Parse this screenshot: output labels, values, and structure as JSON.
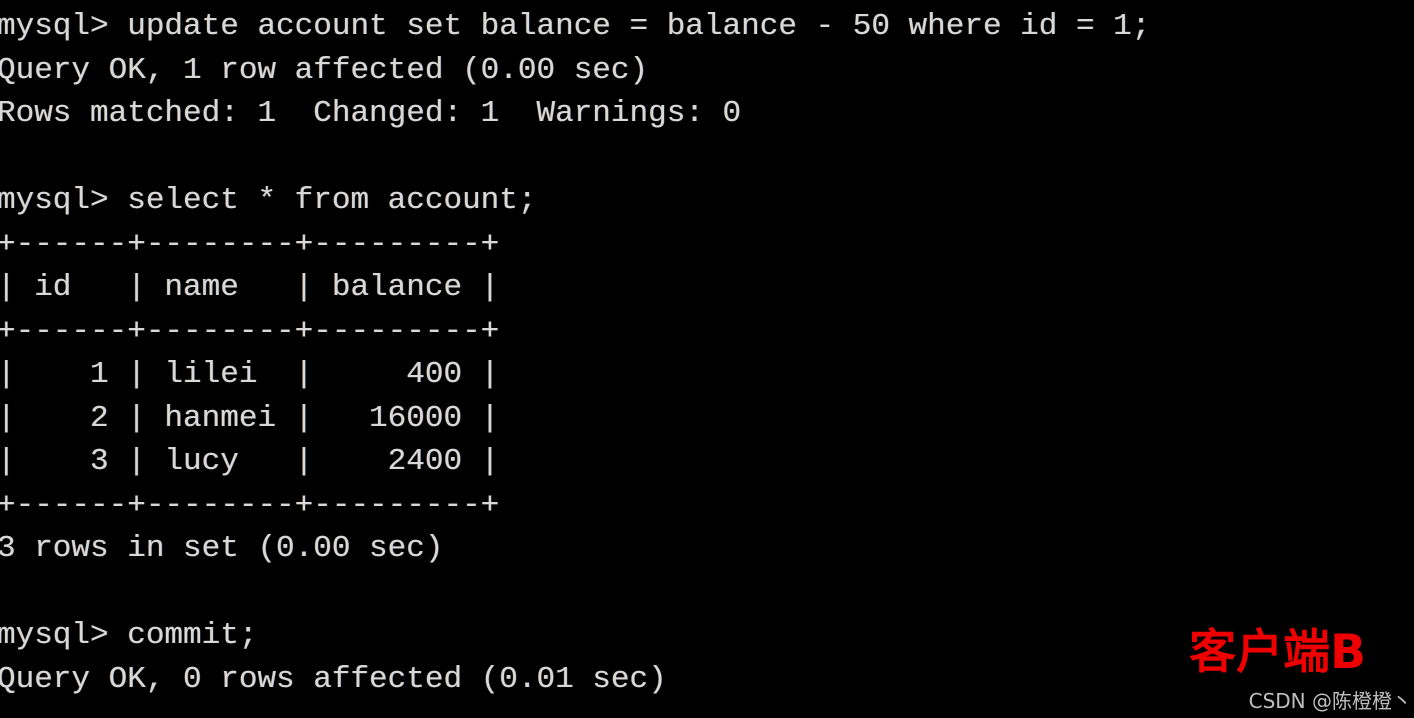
{
  "terminal": {
    "prompt": "mysql>",
    "background_color": "#000000",
    "text_color": "#d8d8d8",
    "lines": [
      "mysql> update account set balance = balance - 50 where id = 1;",
      "Query OK, 1 row affected (0.00 sec)",
      "Rows matched: 1  Changed: 1  Warnings: 0",
      "",
      "mysql> select * from account;",
      "+------+--------+---------+",
      "| id   | name   | balance |",
      "+------+--------+---------+",
      "|    1 | lilei  |     400 |",
      "|    2 | hanmei |   16000 |",
      "|    3 | lucy   |    2400 |",
      "+------+--------+---------+",
      "3 rows in set (0.00 sec)",
      "",
      "mysql> commit;",
      "Query OK, 0 rows affected (0.01 sec)"
    ],
    "commands": [
      "update account set balance = balance - 50 where id = 1;",
      "select * from account;",
      "commit;"
    ],
    "results": [
      {
        "status": "Query OK, 1 row affected (0.00 sec)",
        "detail": "Rows matched: 1  Changed: 1  Warnings: 0"
      },
      {
        "status": "3 rows in set (0.00 sec)",
        "detail": ""
      },
      {
        "status": "Query OK, 0 rows affected (0.01 sec)",
        "detail": ""
      }
    ],
    "result_table": {
      "columns": [
        "id",
        "name",
        "balance"
      ],
      "rows": [
        [
          "1",
          "lilei",
          "400"
        ],
        [
          "2",
          "hanmei",
          "16000"
        ],
        [
          "3",
          "lucy",
          "2400"
        ]
      ],
      "row_count_text": "3 rows in set (0.00 sec)"
    }
  },
  "annotation": {
    "label": "客户端B",
    "color": "#ee0000"
  },
  "watermark": {
    "text": "CSDN @陈橙橙丶",
    "color": "#d0d0d0"
  }
}
